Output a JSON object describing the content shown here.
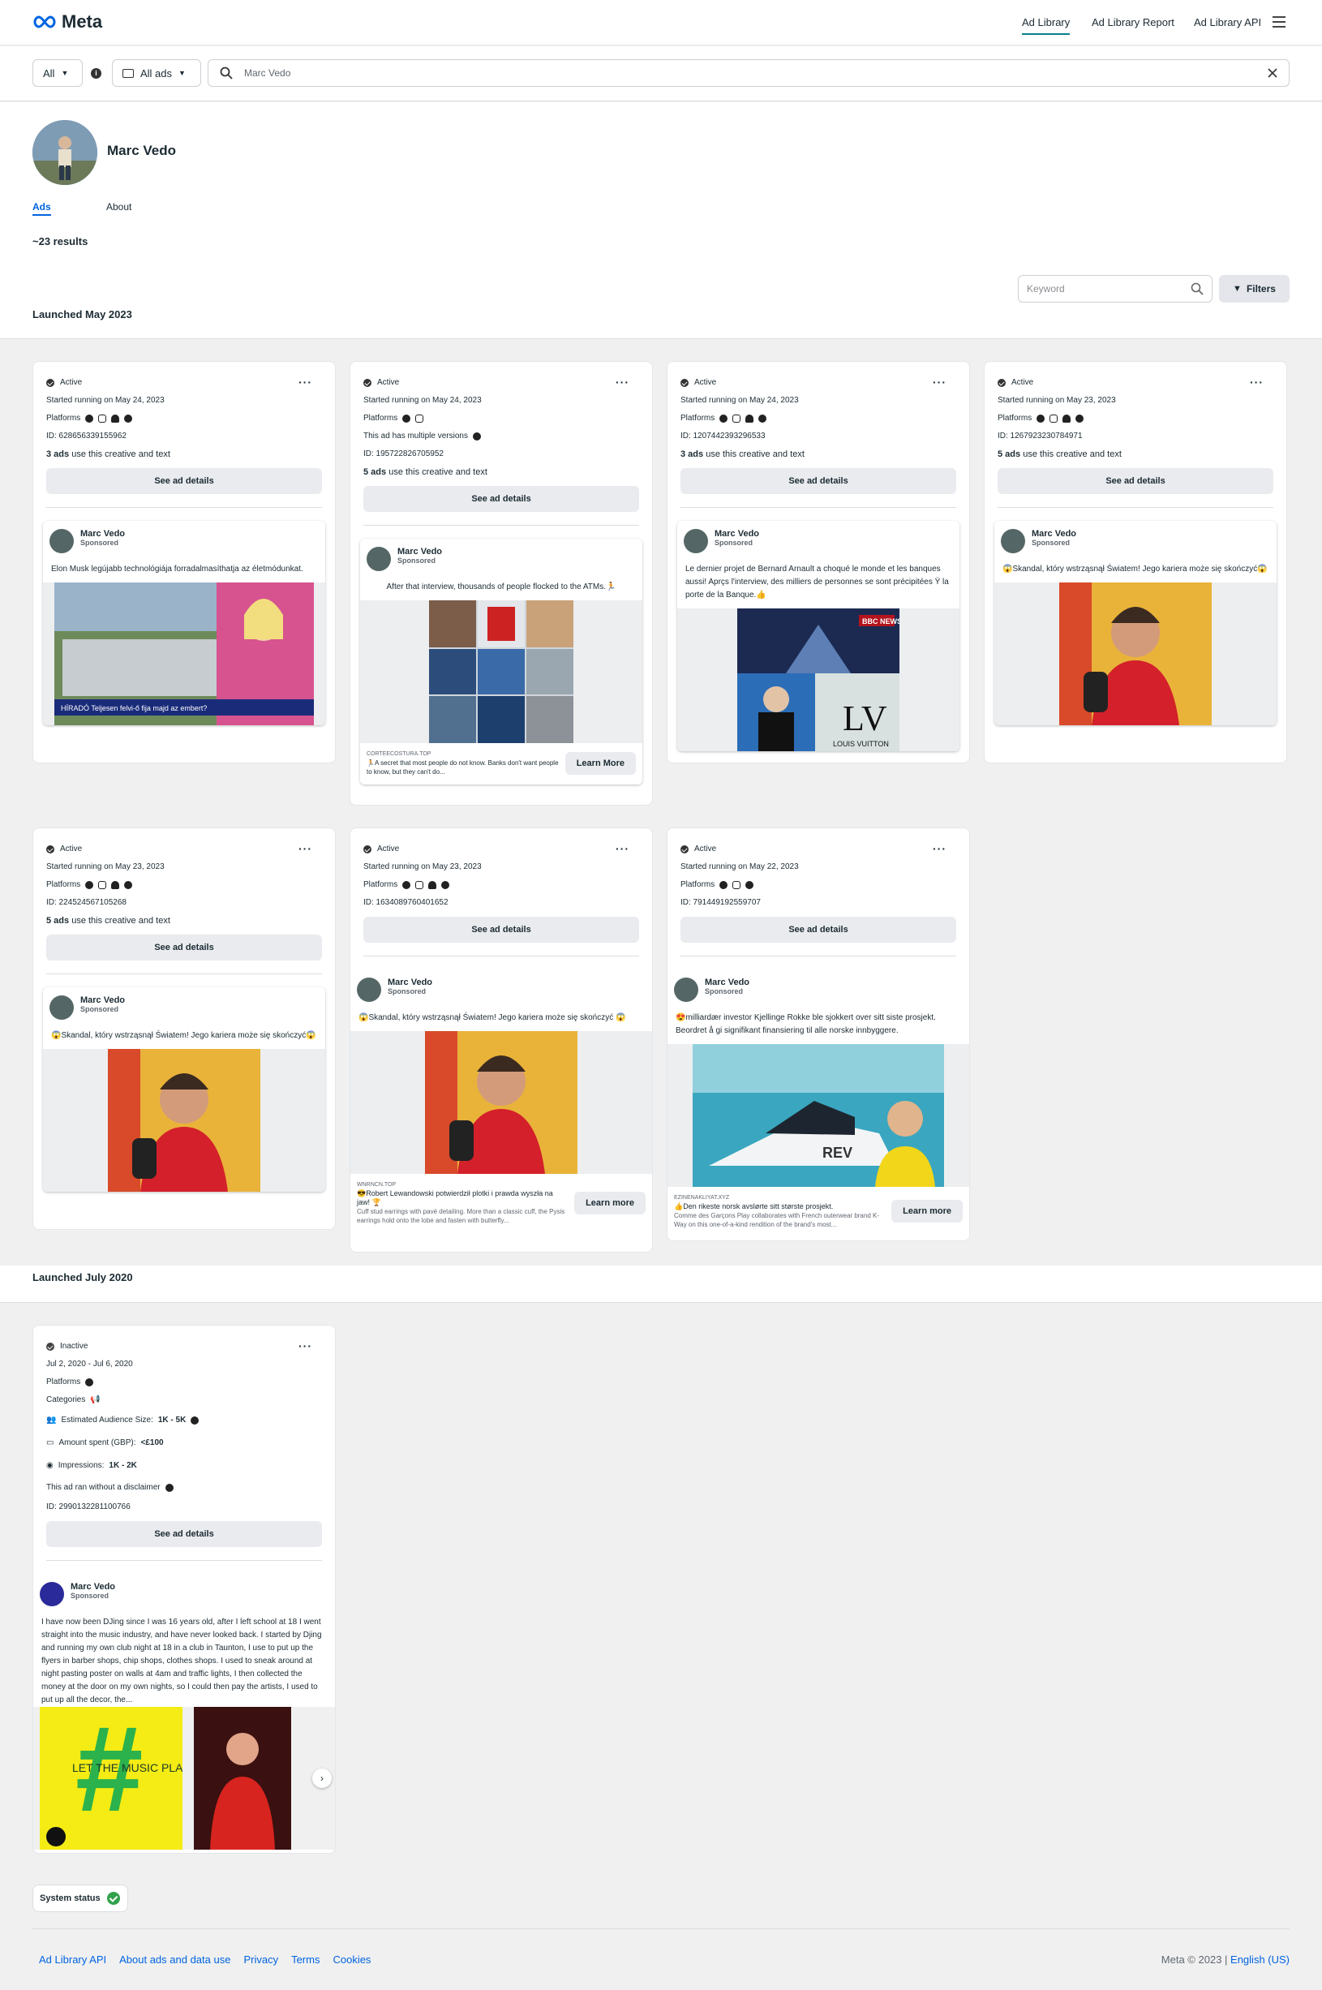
{
  "header": {
    "logo_text": "Meta",
    "nav": [
      "Ad Library",
      "Ad Library Report",
      "Ad Library API"
    ]
  },
  "search": {
    "dropdown_all": "All",
    "dropdown_ads": "All ads",
    "query": "Marc Vedo"
  },
  "profile": {
    "name": "Marc Vedo",
    "tabs": [
      "Ads",
      "About"
    ],
    "results": "~23 results"
  },
  "toolbar": {
    "keyword_placeholder": "Keyword",
    "filters_label": "Filters"
  },
  "sections": [
    "Launched May 2023",
    "Launched July 2020"
  ],
  "labels": {
    "platforms": "Platforms",
    "see_details": "See ad details",
    "sponsored": "Sponsored",
    "categories": "Categories"
  },
  "cards": [
    {
      "status": "Active",
      "started": "Started running on May 24, 2023",
      "id": "ID: 628656339155962",
      "uses_bold": "3 ads",
      "uses_rest": " use this creative and text",
      "advertiser": "Marc Vedo",
      "text": "Elon Musk legújabb technológiája forradalmasíthatja az életmódunkat.",
      "img_label": "HÍRADÓ  Teljesen felvi-ő fija majd az embert?"
    },
    {
      "status": "Active",
      "started": "Started running on May 24, 2023",
      "multi": "This ad has multiple versions",
      "id": "ID: 195722826705952",
      "uses_bold": "5 ads",
      "uses_rest": " use this creative and text",
      "advertiser": "Marc Vedo",
      "text": "After that interview, thousands of people flocked to the ATMs.🏃",
      "cta_domain": "CORTEECOSTURA.TOP",
      "cta_text": "🏃A secret that most people do not know. Banks don't want people to know, but they can't do...",
      "cta_btn": "Learn More"
    },
    {
      "status": "Active",
      "started": "Started running on May 24, 2023",
      "id": "ID: 1207442393296533",
      "uses_bold": "3 ads",
      "uses_rest": " use this creative and text",
      "advertiser": "Marc Vedo",
      "text": "Le dernier projet de Bernard Arnault a choqué le monde et les banques aussi! Aprçs l'interview, des milliers de personnes se sont précipitées Ÿ la porte de la Banque.👍",
      "img_label1": "BBC NEWS",
      "img_label2": "LOUIS VUITTON"
    },
    {
      "status": "Active",
      "started": "Started running on May 23, 2023",
      "id": "ID: 1267923230784971",
      "uses_bold": "5 ads",
      "uses_rest": " use this creative and text",
      "advertiser": "Marc Vedo",
      "text": "😱Skandal, który wstrząsnął Światem! Jego kariera może się skończyć😱"
    },
    {
      "status": "Active",
      "started": "Started running on May 23, 2023",
      "id": "ID: 224524567105268",
      "uses_bold": "5 ads",
      "uses_rest": " use this creative and text",
      "advertiser": "Marc Vedo",
      "text": "😱Skandal, który wstrząsnął Światem! Jego kariera może się skończyć😱"
    },
    {
      "status": "Active",
      "started": "Started running on May 23, 2023",
      "id": "ID: 1634089760401652",
      "advertiser": "Marc Vedo",
      "text": "😱Skandal, który wstrząsnął Światem! Jego kariera może się skończyć 😱",
      "cta_domain": "WNRNCN.TOP",
      "cta_text": "😎Robert Lewandowski potwierdził plotki i prawda wyszła na jaw! 🏆",
      "cta_sub": "Cuff stud earrings with pavé detailing. More than a classic cuff, the Pysis earrings hold onto the lobe and fasten with butterfly...",
      "cta_btn": "Learn more"
    },
    {
      "status": "Active",
      "started": "Started running on May 22, 2023",
      "id": "ID: 791449192559707",
      "advertiser": "Marc Vedo",
      "text": "😍milliardær investor Kjellinge Rokke ble sjokkert over sitt siste prosjekt. Beordret å gi signifikant finansiering til alle norske innbyggere.",
      "cta_domain": "EZINENAKLIYAT.XYZ",
      "cta_text": "👍Den rikeste norsk avslørte sitt største prosjekt.",
      "cta_sub": "Comme des Garçons Play collaborates with French outerwear brand K-Way on this one-of-a-kind rendition of the brand's most...",
      "cta_btn": "Learn more",
      "img_label": "REV"
    },
    {
      "status": "Inactive",
      "started": "Jul 2, 2020 - Jul 6, 2020",
      "audience_label": "Estimated Audience Size:",
      "audience": "1K - 5K",
      "spent_label": "Amount spent (GBP): ",
      "spent": "<£100",
      "impr_label": "Impressions: ",
      "impr": "1K - 2K",
      "disclaimer": "This ad ran without a disclaimer",
      "id": "ID: 2990132281100766",
      "advertiser": "Marc Vedo",
      "text": "I have now been DJing since I was 16 years old, after I left school at 18 I went straight into the music industry, and have never looked back. I started by Djing and running my own club night at 18 in a club in Taunton, I use to put up the flyers in barber shops, chip shops, clothes shops. I used to sneak around at night pasting poster on walls at 4am and traffic lights, I then collected the money at the door on my own nights, so I could then pay the artists, I used to put up all the decor, the...",
      "img_label": "LET THE MUSIC PLAY"
    }
  ],
  "system_status": "System status",
  "footer": {
    "links": [
      "Ad Library API",
      "About ads and data use",
      "Privacy",
      "Terms",
      "Cookies"
    ],
    "copyright": "Meta © 2023 | ",
    "language": "English (US)"
  },
  "colors": {
    "accent": "#0064e0",
    "teal": "#0a7e8c",
    "success": "#31a24c"
  }
}
